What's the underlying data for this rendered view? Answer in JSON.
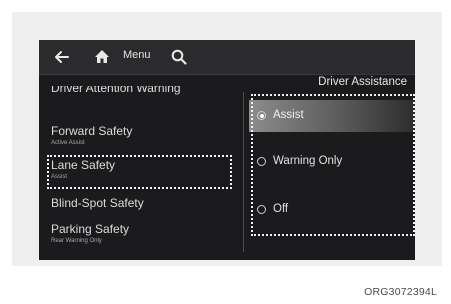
{
  "header": {
    "menu_label": "Menu",
    "icons": [
      "back-arrow-icon",
      "home-icon",
      "search-icon"
    ]
  },
  "right_panel": {
    "title": "Driver Assistance",
    "options": [
      {
        "label": "Assist",
        "selected": true
      },
      {
        "label": "Warning Only",
        "selected": false
      },
      {
        "label": "Off",
        "selected": false
      }
    ]
  },
  "left_menu": {
    "items": [
      {
        "label": "Driver Attention Warning",
        "sub": ""
      },
      {
        "label": "Forward Safety",
        "sub": "Active Assist"
      },
      {
        "label": "Lane Safety",
        "sub": "Assist"
      },
      {
        "label": "Blind-Spot Safety",
        "sub": ""
      },
      {
        "label": "Parking Safety",
        "sub": "Rear Warning Only"
      }
    ]
  },
  "figure_code": "ORG3072394L"
}
